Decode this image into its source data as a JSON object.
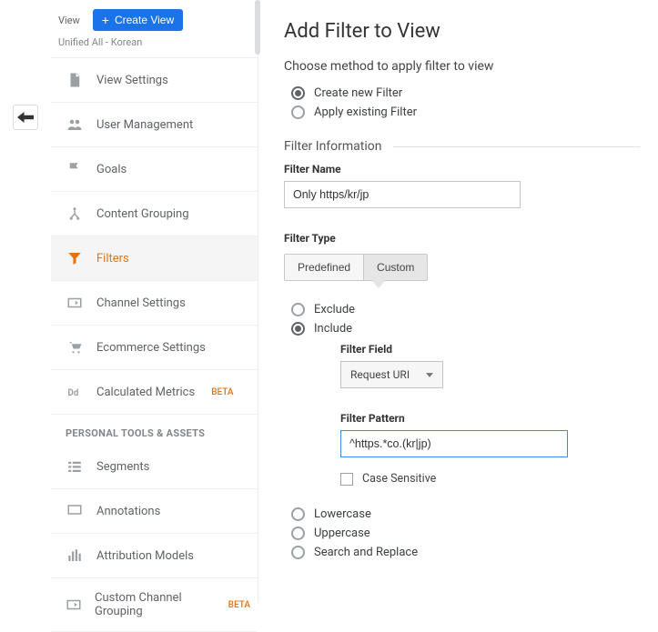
{
  "back_tooltip": "Back",
  "sidebar": {
    "header_label": "View",
    "create_button": "Create View",
    "subtitle": "Unified All - Korean",
    "section_personal": "PERSONAL TOOLS & ASSETS",
    "beta": "BETA",
    "items": {
      "view_settings": "View Settings",
      "user_management": "User Management",
      "goals": "Goals",
      "content_grouping": "Content Grouping",
      "filters": "Filters",
      "channel_settings": "Channel Settings",
      "ecommerce_settings": "Ecommerce Settings",
      "calculated_metrics": "Calculated Metrics",
      "segments": "Segments",
      "annotations": "Annotations",
      "attribution_models": "Attribution Models",
      "custom_channel_grouping": "Custom Channel Grouping"
    }
  },
  "main": {
    "title": "Add Filter to View",
    "choose_method": "Choose method to apply filter to view",
    "method_create": "Create new Filter",
    "method_existing": "Apply existing Filter",
    "filter_info": "Filter Information",
    "filter_name_label": "Filter Name",
    "filter_name_value": "Only https/kr/jp",
    "filter_type_label": "Filter Type",
    "predefined": "Predefined",
    "custom": "Custom",
    "exclude": "Exclude",
    "include": "Include",
    "filter_field_label": "Filter Field",
    "filter_field_value": "Request URI",
    "filter_pattern_label": "Filter Pattern",
    "filter_pattern_value": "^https.*co.(kr|jp)",
    "case_sensitive": "Case Sensitive",
    "lowercase": "Lowercase",
    "uppercase": "Uppercase",
    "search_replace": "Search and Replace"
  }
}
